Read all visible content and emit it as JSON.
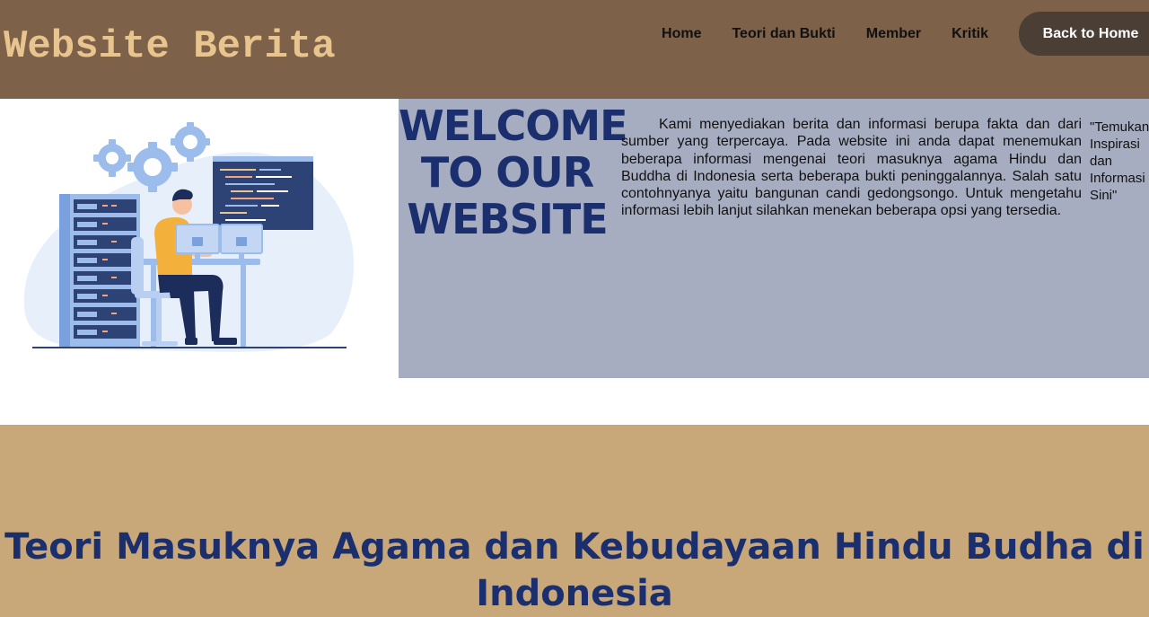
{
  "header": {
    "site_title": "Website Berita",
    "nav": [
      "Home",
      "Teori dan Bukti",
      "Member",
      "Kritik"
    ],
    "cta_label": "Back to Home"
  },
  "hero": {
    "welcome_title": "WELCOME TO OUR WEBSITE",
    "intro": "Kami menyediakan berita dan informasi berupa fakta dan dari sumber yang terpercaya. Pada website ini anda dapat menemukan beberapa informasi mengenai teori masuknya agama Hindu dan Buddha di Indonesia serta beberapa bukti peninggalannya. Salah satu contohnyanya yaitu bangunan candi gedongsongo. Untuk mengetahu informasi lebih lanjut silahkan menekan beberapa opsi yang tersedia.",
    "quote": "\"Temukan Inspirasi dan Informasi di Sini\"",
    "illustration": "developer-server-illustration"
  },
  "section": {
    "title": "Teori Masuknya Agama dan Kebudayaan Hindu Budha di Indonesia"
  },
  "colors": {
    "header_bg": "#7d6149",
    "title_color": "#e8c48e",
    "cta_bg": "#4a3e35",
    "hero_panel_bg": "#a7adc1",
    "section_bg": "#c8a878",
    "heading_navy": "#1b2f6e"
  }
}
